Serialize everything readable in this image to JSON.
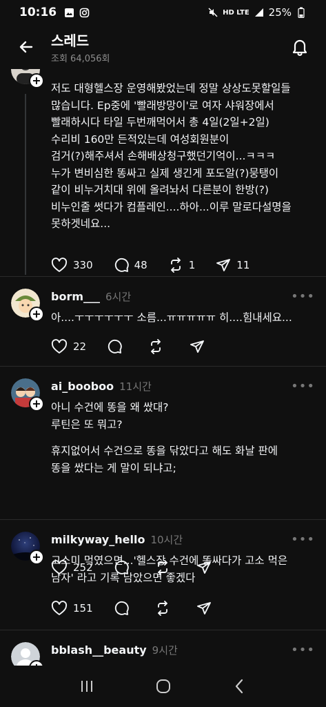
{
  "status_bar": {
    "time": "10:16",
    "network": "HD LTE",
    "battery": "25%"
  },
  "header": {
    "title": "스레드",
    "views": "조회 64,056회"
  },
  "posts": [
    {
      "username": "",
      "time": "",
      "lines": [
        "저도 대형헬스장 운영해봤었는데 정말 상상도못할일들",
        "많습니다. Ep중에 '빨래방망이'로 여자 샤워장에서",
        "빨래하시다 타일 두번깨먹어서 총 4일(2일+2일)",
        "수리비 160만 든적있는데 여성회원분이",
        "검거(?)해주셔서 손해배상청구했던기억이...ㅋㅋㅋ",
        "누가 변비심한 똥싸고 실제 생긴게 포도알(?)뭉탱이",
        "같이 비누거치대 위에 올려놔서 다른분이 한방(?)",
        "비누인줄 썻다가 컴플레인....하아...이루 말로다설명을",
        "못하겟네요..."
      ],
      "likes": "330",
      "comments": "48",
      "reposts": "1",
      "shares": "11"
    },
    {
      "username": "borm___",
      "time": "6시간",
      "lines": [
        "아....ㅜㅜㅜㅜㅜㅜ 소름...ㅠㅠㅠㅠㅠ 히....힘내세요..."
      ],
      "likes": "22"
    },
    {
      "username": "ai_booboo",
      "time": "11시간",
      "lines": [
        "아니 수건에 똥을 왜 쌌대?",
        "루틴은 또 뭐고?"
      ],
      "lines2": [
        "휴지없어서 수건으로 똥을 닦았다고 해도 화날 판에",
        "똥을 쌌다는 게 말이 되냐고;"
      ],
      "likes": "252"
    },
    {
      "username": "milkyway_hello",
      "time": "10시간",
      "lines": [
        "고소미 먹였으면...'헬스장 수건에 똥싸다가 고소 먹은",
        "남자' 라고 기록 남았으면 좋겠다"
      ],
      "likes": "151"
    },
    {
      "username": "bblash__beauty",
      "time": "9시간"
    }
  ],
  "icons": {
    "back": "arrow-left-icon",
    "bell": "bell-icon",
    "like": "heart-icon",
    "comment": "comment-icon",
    "repost": "repost-icon",
    "share": "send-icon",
    "more": "more-icon"
  },
  "colors": {
    "background": "#101010",
    "text": "#f3f5f7",
    "muted": "#777777",
    "divider": "#2a2a2a"
  }
}
